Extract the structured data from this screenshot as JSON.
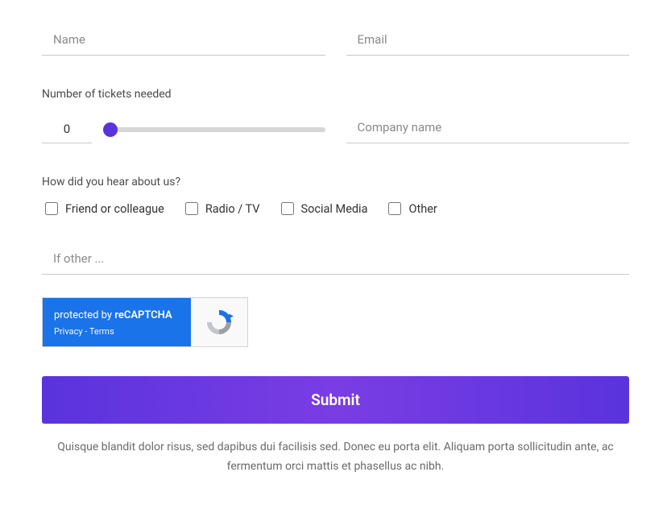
{
  "form": {
    "name": {
      "placeholder": "Name",
      "value": ""
    },
    "email": {
      "placeholder": "Email",
      "value": ""
    },
    "tickets_label": "Number of tickets needed",
    "tickets_value": "0",
    "company": {
      "placeholder": "Company name",
      "value": ""
    },
    "hear_label": "How did you hear about us?",
    "hear_options": [
      {
        "label": "Friend or colleague"
      },
      {
        "label": "Radio / TV"
      },
      {
        "label": "Social Media"
      },
      {
        "label": "Other"
      }
    ],
    "other_placeholder": "If other ...",
    "other_value": ""
  },
  "recaptcha": {
    "protected": "protected by ",
    "brand": "reCAPTCHA",
    "privacy": "Privacy",
    "sep": " - ",
    "terms": "Terms"
  },
  "submit_label": "Submit",
  "footer": "Quisque blandit dolor risus, sed dapibus dui facilisis sed. Donec eu porta elit. Aliquam porta sollicitudin ante, ac fermentum orci mattis et phasellus ac nibh."
}
